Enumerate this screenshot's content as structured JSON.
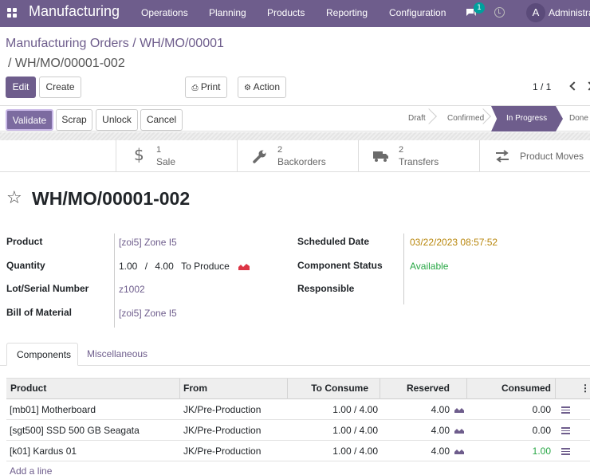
{
  "navbar": {
    "app_name": "Manufacturing",
    "menus": [
      "Operations",
      "Planning",
      "Products",
      "Reporting",
      "Configuration"
    ],
    "message_count": "1",
    "avatar_letter": "A",
    "user_name": "Administrator"
  },
  "breadcrumb": {
    "parent1": "Manufacturing Orders",
    "parent2": "WH/MO/00001",
    "current": "WH/MO/00001-002"
  },
  "control_panel": {
    "edit_label": "Edit",
    "create_label": "Create",
    "print_label": "Print",
    "action_label": "Action",
    "pager": "1 / 1"
  },
  "statusbar": {
    "buttons": [
      "Validate",
      "Scrap",
      "Unlock",
      "Cancel"
    ],
    "stages": [
      "Draft",
      "Confirmed",
      "In Progress",
      "Done"
    ],
    "active_stage": "In Progress"
  },
  "smart_buttons": [
    {
      "icon": "dollar-icon",
      "count": "1",
      "label": "Sale"
    },
    {
      "icon": "wrench-icon",
      "count": "2",
      "label": "Backorders"
    },
    {
      "icon": "truck-icon",
      "count": "2",
      "label": "Transfers"
    },
    {
      "icon": "arrows-icon",
      "count": "",
      "label": "Product Moves"
    }
  ],
  "record": {
    "name": "WH/MO/00001-002",
    "fields_left": {
      "product_label": "Product",
      "product_value": "[zoi5] Zone I5",
      "quantity_label": "Quantity",
      "quantity_done": "1.00",
      "quantity_sep": "/",
      "quantity_total": "4.00",
      "quantity_suffix": "To Produce",
      "lot_label": "Lot/Serial Number",
      "lot_value": "z1002",
      "bom_label": "Bill of Material",
      "bom_value": "[zoi5] Zone I5"
    },
    "fields_right": {
      "scheduled_label": "Scheduled Date",
      "scheduled_value": "03/22/2023 08:57:52",
      "component_status_label": "Component Status",
      "component_status_value": "Available",
      "responsible_label": "Responsible",
      "responsible_value": ""
    }
  },
  "tabs": [
    "Components",
    "Miscellaneous"
  ],
  "components_table": {
    "headers": [
      "Product",
      "From",
      "To Consume",
      "Reserved",
      "Consumed"
    ],
    "rows": [
      {
        "product": "[mb01] Motherboard",
        "from": "JK/Pre-Production",
        "to_consume": "1.00 / 4.00",
        "reserved": "4.00",
        "consumed": "0.00"
      },
      {
        "product": "[sgt500] SSD 500 GB Seagata",
        "from": "JK/Pre-Production",
        "to_consume": "1.00 / 4.00",
        "reserved": "4.00",
        "consumed": "0.00"
      },
      {
        "product": "[k01] Kardus 01",
        "from": "JK/Pre-Production",
        "to_consume": "1.00 / 4.00",
        "reserved": "4.00",
        "consumed": "1.00"
      }
    ],
    "add_line": "Add a line"
  },
  "colors": {
    "brand": "#6e5d8c",
    "scheduled_date": "#b8860b",
    "available": "#28a745",
    "forecast_icon": "#dc3545"
  }
}
